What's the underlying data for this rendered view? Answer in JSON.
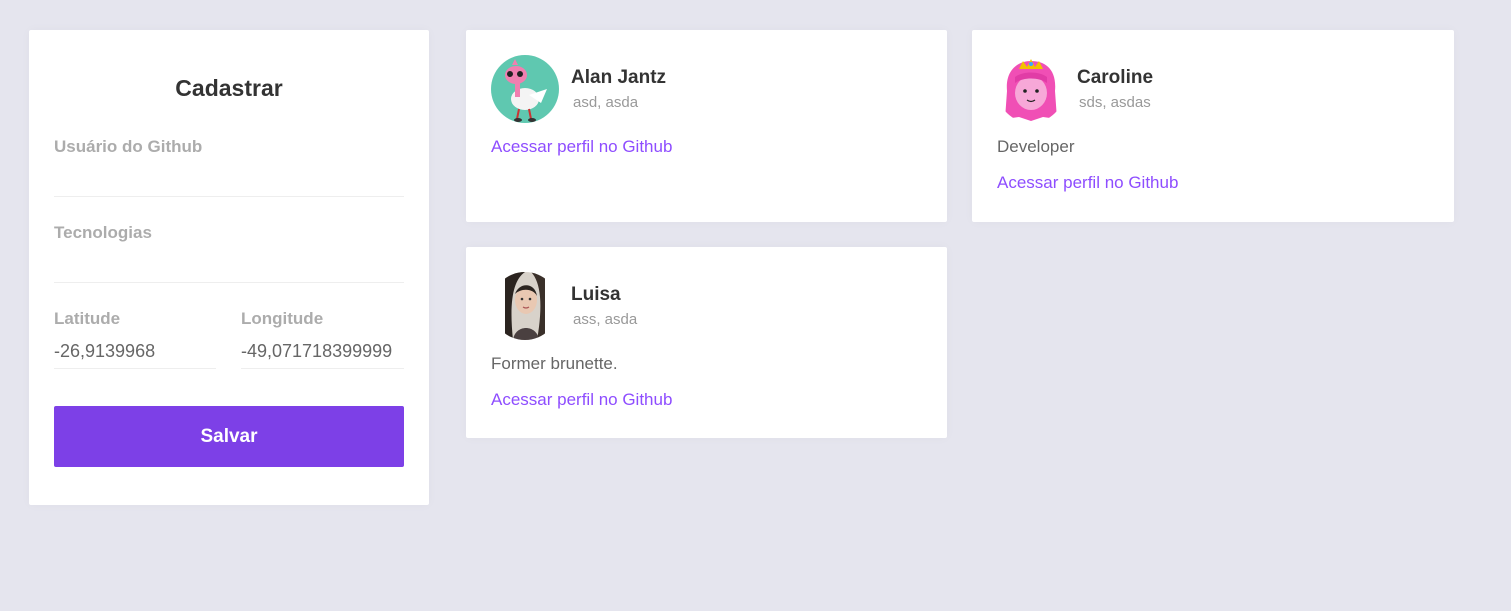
{
  "form": {
    "title": "Cadastrar",
    "github_username": {
      "label": "Usuário do Github",
      "value": ""
    },
    "techs": {
      "label": "Tecnologias",
      "value": ""
    },
    "latitude": {
      "label": "Latitude",
      "value": "-26,9139968"
    },
    "longitude": {
      "label": "Longitude",
      "value": "-49,071718399999"
    },
    "submit_label": "Salvar"
  },
  "devs": [
    {
      "name": "Alan Jantz",
      "techs": "asd, asda",
      "bio": "",
      "link_label": "Acessar perfil no Github",
      "avatar": "cartoon-character-avatar",
      "avatar_bg": "#5fc8b0"
    },
    {
      "name": "Caroline",
      "techs": "sds, asdas",
      "bio": "Developer",
      "link_label": "Acessar perfil no Github",
      "avatar": "princess-bubblegum-avatar",
      "avatar_bg": "#ffffff"
    },
    {
      "name": "Luisa",
      "techs": "ass, asda",
      "bio": "Former brunette.",
      "link_label": "Acessar perfil no Github",
      "avatar": "photo-avatar",
      "avatar_bg": "#ffffff"
    }
  ],
  "colors": {
    "background": "#e5e5ee",
    "accent": "#7d40e7",
    "link": "#8e4dff"
  }
}
